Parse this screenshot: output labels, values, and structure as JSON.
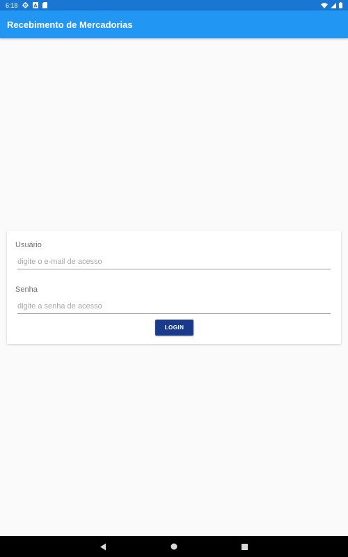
{
  "status_bar": {
    "time": "6:18",
    "icons": [
      "gear-icon",
      "a-notification-icon",
      "sd-card-icon",
      "wifi-icon",
      "cellular-signal-icon",
      "battery-icon"
    ]
  },
  "app_bar": {
    "title": "Recebimento de Mercadorias",
    "color": "#2196f3"
  },
  "login_form": {
    "user_label": "Usuário",
    "user_placeholder": "digite o e-mail de acesso",
    "password_label": "Senha",
    "password_placeholder": "digite a senha de acesso",
    "login_button": "LOGIN",
    "button_color": "#1a3a8c"
  },
  "nav_bar": {
    "buttons": [
      "back-icon",
      "home-icon",
      "recents-icon"
    ]
  }
}
